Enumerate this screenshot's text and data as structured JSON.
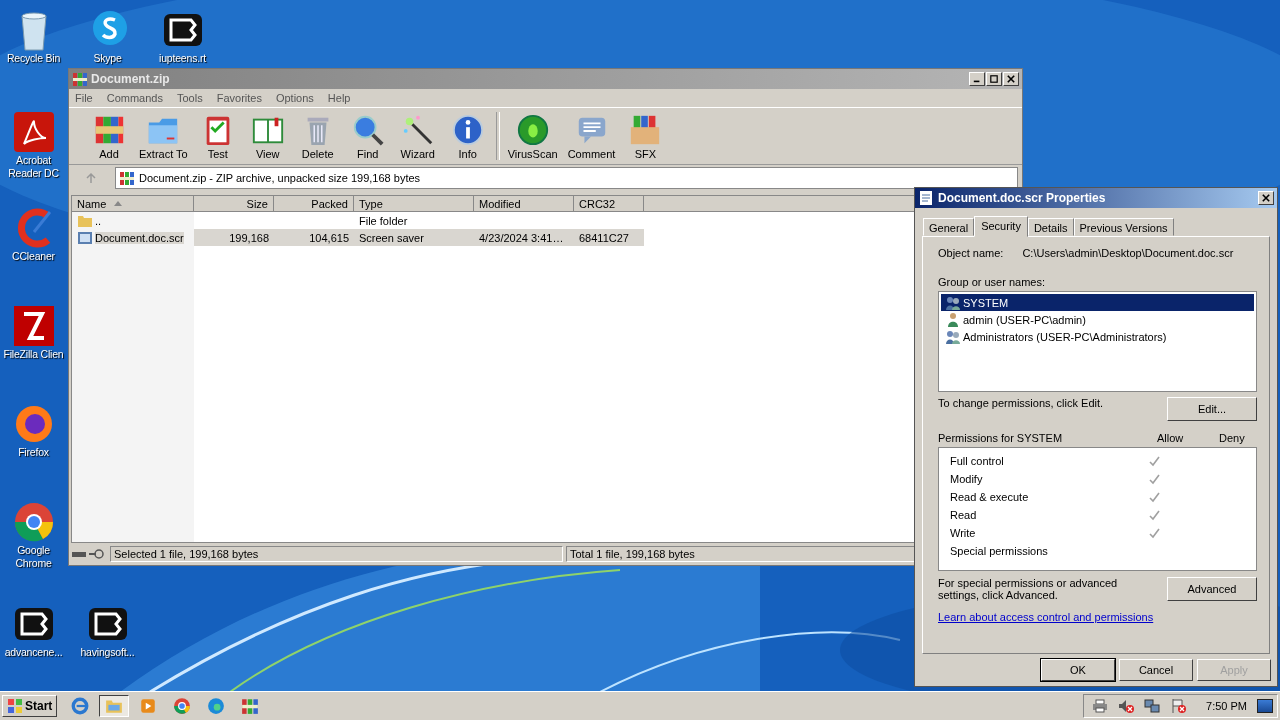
{
  "desktop_icons": [
    {
      "label": "Recycle Bin",
      "kind": "recycle"
    },
    {
      "label": "Skype",
      "kind": "skype"
    },
    {
      "label": "iupteens.rt",
      "kind": "logo"
    },
    {
      "label": "Acrobat Reader DC",
      "kind": "acrobat"
    },
    {
      "label": "CCleaner",
      "kind": "ccleaner"
    },
    {
      "label": "FileZilla Clien",
      "kind": "filezilla"
    },
    {
      "label": "Firefox",
      "kind": "firefox"
    },
    {
      "label": "Google Chrome",
      "kind": "chrome"
    },
    {
      "label": "advancene...",
      "kind": "logo"
    },
    {
      "label": "havingsoft...",
      "kind": "logo"
    }
  ],
  "archiver": {
    "title": "Document.zip",
    "menu": [
      "File",
      "Commands",
      "Tools",
      "Favorites",
      "Options",
      "Help"
    ],
    "toolbar": [
      {
        "label": "Add",
        "kind": "add"
      },
      {
        "label": "Extract To",
        "kind": "extract"
      },
      {
        "label": "Test",
        "kind": "test"
      },
      {
        "label": "View",
        "kind": "view"
      },
      {
        "label": "Delete",
        "kind": "delete"
      },
      {
        "label": "Find",
        "kind": "find"
      },
      {
        "label": "Wizard",
        "kind": "wizard"
      },
      {
        "label": "Info",
        "kind": "info"
      },
      {
        "label": "VirusScan",
        "kind": "virusscan"
      },
      {
        "label": "Comment",
        "kind": "comment"
      },
      {
        "label": "SFX",
        "kind": "sfx"
      }
    ],
    "address": "Document.zip - ZIP archive, unpacked size 199,168 bytes",
    "columns": [
      {
        "label": "Name",
        "sorted": true
      },
      {
        "label": "Size",
        "sorted": false
      },
      {
        "label": "Packed",
        "sorted": false
      },
      {
        "label": "Type",
        "sorted": false
      },
      {
        "label": "Modified",
        "sorted": false
      },
      {
        "label": "CRC32",
        "sorted": false
      }
    ],
    "rows": [
      {
        "kind": "folder",
        "cells": [
          "..",
          "",
          "",
          "File folder",
          "",
          ""
        ],
        "selected": false
      },
      {
        "kind": "file",
        "cells": [
          "Document.doc.scr",
          "199,168",
          "104,615",
          "Screen saver",
          "4/23/2024 3:41…",
          "68411C27"
        ],
        "selected": true
      }
    ],
    "status": [
      "Selected 1 file, 199,168 bytes",
      "Total 1 file, 199,168 bytes"
    ]
  },
  "properties": {
    "title": "Document.doc.scr Properties",
    "tabs": [
      {
        "label": "General",
        "selected": false
      },
      {
        "label": "Security",
        "selected": true
      },
      {
        "label": "Details",
        "selected": false
      },
      {
        "label": "Previous Versions",
        "selected": false
      }
    ],
    "object_label": "Object name:",
    "object_name": "C:\\Users\\admin\\Desktop\\Document.doc.scr",
    "group_label": "Group or user names:",
    "users": [
      {
        "name": "SYSTEM",
        "kind": "group",
        "selected": true
      },
      {
        "name": "admin (USER-PC\\admin)",
        "kind": "user",
        "selected": false
      },
      {
        "name": "Administrators (USER-PC\\Administrators)",
        "kind": "group",
        "selected": false
      }
    ],
    "change_text": "To change permissions, click Edit.",
    "edit_button": "Edit...",
    "perm_label": "Permissions for SYSTEM",
    "allow": "Allow",
    "deny": "Deny",
    "permissions": [
      {
        "name": "Full control",
        "allow": true
      },
      {
        "name": "Modify",
        "allow": true
      },
      {
        "name": "Read & execute",
        "allow": true
      },
      {
        "name": "Read",
        "allow": true
      },
      {
        "name": "Write",
        "allow": true
      },
      {
        "name": "Special permissions",
        "allow": false
      }
    ],
    "advanced_text": "For special permissions or advanced settings, click Advanced.",
    "advanced_button": "Advanced",
    "link": "Learn about access control and permissions",
    "buttons": [
      {
        "label": "OK",
        "disabled": false
      },
      {
        "label": "Cancel",
        "disabled": false
      },
      {
        "label": "Apply",
        "disabled": true
      }
    ]
  },
  "taskbar": {
    "start": "Start",
    "apps": [
      {
        "kind": "ie",
        "selected": false
      },
      {
        "kind": "explorer",
        "selected": true
      },
      {
        "kind": "media",
        "selected": false
      },
      {
        "kind": "chrome",
        "selected": false
      },
      {
        "kind": "edge",
        "selected": false
      },
      {
        "kind": "winrar",
        "selected": false
      }
    ],
    "time": "7:50 PM"
  }
}
